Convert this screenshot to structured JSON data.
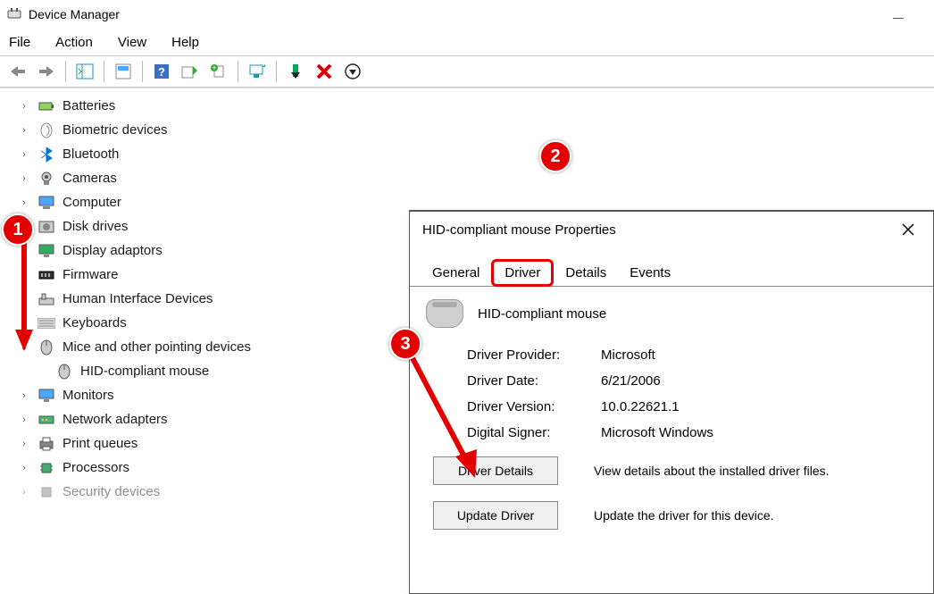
{
  "window": {
    "title": "Device Manager"
  },
  "menubar": [
    "File",
    "Action",
    "View",
    "Help"
  ],
  "tree": {
    "items": [
      {
        "label": "Batteries"
      },
      {
        "label": "Biometric devices"
      },
      {
        "label": "Bluetooth"
      },
      {
        "label": "Cameras"
      },
      {
        "label": "Computer"
      },
      {
        "label": "Disk drives"
      },
      {
        "label": "Display adaptors"
      },
      {
        "label": "Firmware"
      },
      {
        "label": "Human Interface Devices"
      },
      {
        "label": "Keyboards"
      },
      {
        "label": "Mice and other pointing devices",
        "expanded": true,
        "children": [
          {
            "label": "HID-compliant mouse"
          }
        ]
      },
      {
        "label": "Monitors"
      },
      {
        "label": "Network adapters"
      },
      {
        "label": "Print queues"
      },
      {
        "label": "Processors"
      },
      {
        "label": "Security devices"
      }
    ]
  },
  "dialog": {
    "title": "HID-compliant mouse Properties",
    "tabs": [
      "General",
      "Driver",
      "Details",
      "Events"
    ],
    "active_tab": "Driver",
    "device_name": "HID-compliant mouse",
    "info": {
      "provider_label": "Driver Provider:",
      "provider_value": "Microsoft",
      "date_label": "Driver Date:",
      "date_value": "6/21/2006",
      "version_label": "Driver Version:",
      "version_value": "10.0.22621.1",
      "signer_label": "Digital Signer:",
      "signer_value": "Microsoft Windows"
    },
    "buttons": {
      "details_label": "Driver Details",
      "details_desc": "View details about the installed driver files.",
      "update_label": "Update Driver",
      "update_desc": "Update the driver for this device."
    }
  },
  "annotations": {
    "b1": "1",
    "b2": "2",
    "b3": "3"
  }
}
